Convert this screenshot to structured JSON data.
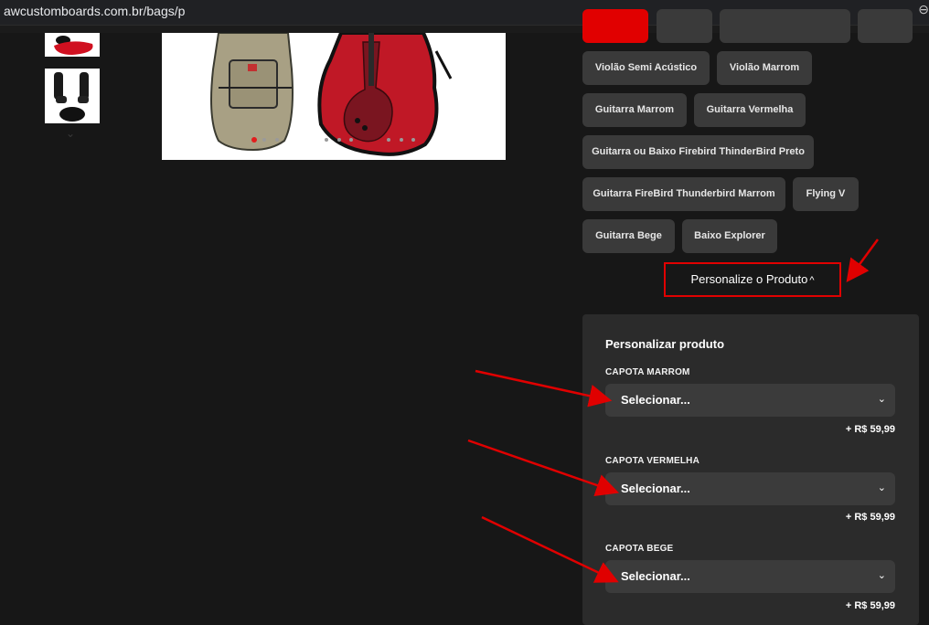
{
  "browser": {
    "url": "awcustomboards.com.br/bags/p",
    "zoom_icon": "zoom-icon"
  },
  "gallery": {
    "thumbnail_chevron_icon": "chevron-down-icon",
    "carousel_active_dot_color": "#e21d1d"
  },
  "variant_chips": [
    {
      "label": ""
    },
    {
      "label": ""
    },
    {
      "label": ""
    },
    {
      "label": ""
    },
    {
      "label": "Violão Semi Acústico"
    },
    {
      "label": "Violão Marrom"
    },
    {
      "label": "Guitarra Marrom"
    },
    {
      "label": "Guitarra Vermelha"
    },
    {
      "label": "Guitarra ou Baixo Firebird ThinderBird Preto"
    },
    {
      "label": "Guitarra FireBird Thunderbird Marrom"
    },
    {
      "label": "Flying V"
    },
    {
      "label": "Guitarra Bege"
    },
    {
      "label": "Baixo Explorer"
    }
  ],
  "personalize_toggle": {
    "label": "Personalize o Produto",
    "caret_icon": "chevron-up-icon"
  },
  "customize_panel": {
    "title": "Personalizar produto",
    "options": [
      {
        "label": "CAPOTA MARROM",
        "select_value": "Selecionar...",
        "price": "+ R$ 59,99"
      },
      {
        "label": "CAPOTA VERMELHA",
        "select_value": "Selecionar...",
        "price": "+ R$ 59,99"
      },
      {
        "label": "CAPOTA BEGE",
        "select_value": "Selecionar...",
        "price": "+ R$ 59,99"
      }
    ]
  },
  "colors": {
    "background": "#171717",
    "accent_red": "#e10000",
    "chip_bg": "#3a3a3a",
    "panel_bg": "#2b2b2b",
    "annotation_arrow": "#e00000"
  }
}
